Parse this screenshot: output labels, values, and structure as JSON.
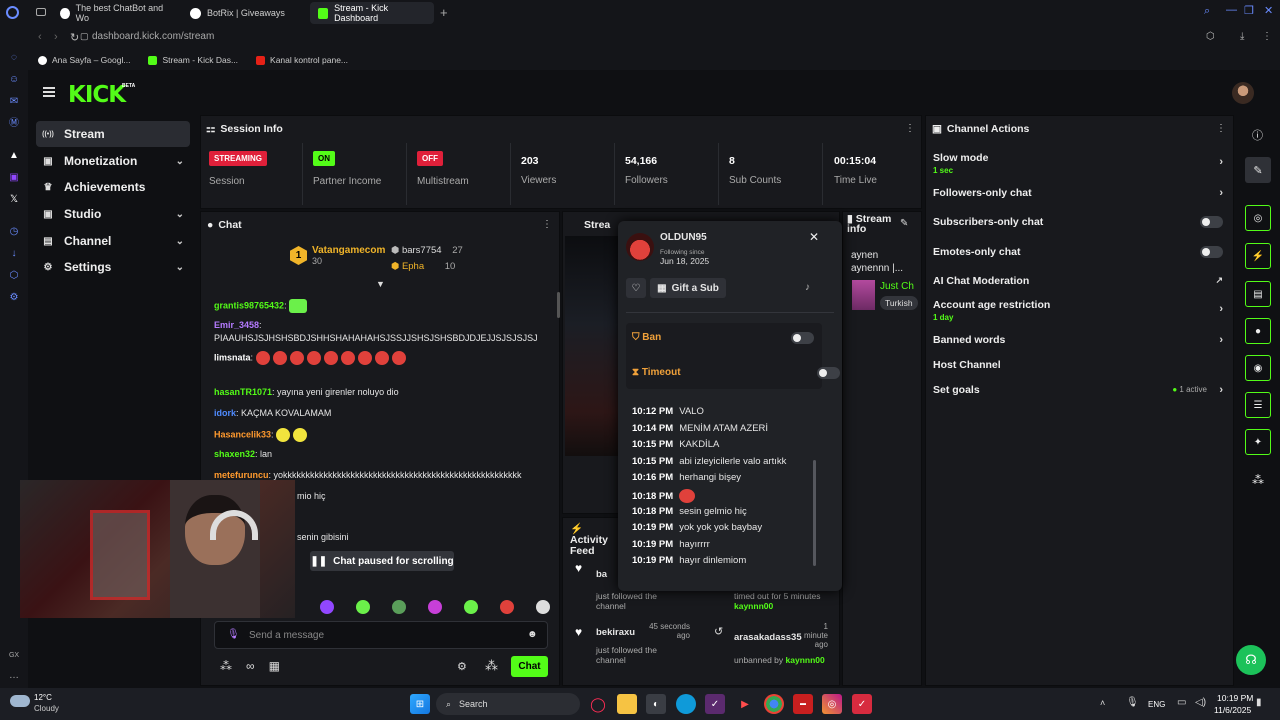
{
  "browser": {
    "tabs": [
      {
        "label": "The best ChatBot and Wo"
      },
      {
        "label": "BotRix | Giveaways"
      },
      {
        "label": "Stream - Kick Dashboard"
      }
    ],
    "url": "dashboard.kick.com/stream",
    "bookmarks": [
      "Ana Sayfa – Googl...",
      "Stream - Kick Das...",
      "Kanal kontrol pane..."
    ]
  },
  "brand": {
    "logo": "KICK",
    "beta": "BETA",
    "accent": "#53fc18"
  },
  "sidebar": {
    "items": [
      {
        "label": "Stream",
        "icon": "broadcast-icon",
        "glyph": "((•))"
      },
      {
        "label": "Monetization",
        "icon": "wallet-icon",
        "glyph": "▣"
      },
      {
        "label": "Achievements",
        "icon": "trophy-icon",
        "glyph": "♛"
      },
      {
        "label": "Studio",
        "icon": "studio-icon",
        "glyph": "▣"
      },
      {
        "label": "Channel",
        "icon": "channel-icon",
        "glyph": "▤"
      },
      {
        "label": "Settings",
        "icon": "gear-icon",
        "glyph": "⚙"
      }
    ]
  },
  "session": {
    "title": "Session Info",
    "stats": [
      {
        "badge": "STREAMING",
        "label": "Session"
      },
      {
        "badge": "ON",
        "label": "Partner Income"
      },
      {
        "badge": "OFF",
        "label": "Multistream"
      },
      {
        "value": "203",
        "label": "Viewers"
      },
      {
        "value": "54,166",
        "label": "Followers"
      },
      {
        "value": "8",
        "label": "Sub Counts"
      },
      {
        "value": "00:15:04",
        "label": "Time Live"
      }
    ]
  },
  "chat": {
    "title": "Chat",
    "top_gifters": [
      {
        "rank": "1",
        "name": "Vatangamecom",
        "count": "30"
      },
      {
        "name": "bars7754",
        "count": "27"
      },
      {
        "name": "Epha",
        "count": "10"
      }
    ],
    "messages": [
      {
        "user": "grantis98765432",
        "text": "",
        "color": "#53fc18"
      },
      {
        "user": "Emir_3458",
        "text": "PIAAUHSJSJHSHSBDJSHHSHAHAHAHSJSSJJSHSJSHSBDJDJEJJSJSJSJSJ",
        "color": "#b57bff"
      },
      {
        "user": "limsnata",
        "text": "",
        "color": "#53fc18"
      },
      {
        "user": "hasanTR1071",
        "text": "yayına yeni girenler noluyo dio",
        "color": "#53fc18"
      },
      {
        "user": "idork",
        "text": "KAÇMA KOVALAMAM",
        "color": "#4f8bff"
      },
      {
        "user": "Hasancelik33",
        "text": "",
        "color": "#ff9a2e"
      },
      {
        "user": "shaxen32",
        "text": "lan",
        "color": "#53fc18"
      },
      {
        "user": "metefuruncu",
        "text": "yokkkkkkkkkkkkkkkkkkkkkkkkkkkkkkkkkkkkkkkkkkkkkkkkkkkkk",
        "color": "#ff9a2e"
      },
      {
        "user": "",
        "text": "mio hiç",
        "color": "#53fc18"
      },
      {
        "user": "",
        "text": "senin gibisini",
        "color": "#53fc18"
      }
    ],
    "paused": "Chat paused for scrolling",
    "input_placeholder": "Send a message",
    "send": "Chat"
  },
  "popup": {
    "username": "OLDUN95",
    "following_label": "Following since",
    "following_date": "Jun 18, 2025",
    "gift": "Gift a Sub",
    "ban": "Ban",
    "timeout": "Timeout",
    "history": [
      {
        "time": "10:12 PM",
        "text": "VALO"
      },
      {
        "time": "10:14 PM",
        "text": "MENİM ATAM AZERİ"
      },
      {
        "time": "10:15 PM",
        "text": "KAKDİLA"
      },
      {
        "time": "10:15 PM",
        "text": "abi izleyicilerle valo artıkk"
      },
      {
        "time": "10:16 PM",
        "text": "herhangi bişey"
      },
      {
        "time": "10:18 PM",
        "text": ""
      },
      {
        "time": "10:18 PM",
        "text": "sesin gelmio hiç"
      },
      {
        "time": "10:19 PM",
        "text": "yok yok yok baybay"
      },
      {
        "time": "10:19 PM",
        "text": "hayırrrr"
      },
      {
        "time": "10:19 PM",
        "text": "hayır dinlemiom"
      }
    ]
  },
  "stream_panel": {
    "title": "Strea"
  },
  "stream_info": {
    "title": "Stream info",
    "stream_title": "aynen aynennn |...",
    "category": "Just Ch",
    "tag": "Turkish"
  },
  "activity": {
    "title": "Activity Feed",
    "items": [
      {
        "user": "ba",
        "action": "just followed the channel",
        "time": ""
      },
      {
        "user": "bekiraxu",
        "action": "just followed the channel",
        "time": "45 seconds ago"
      }
    ],
    "mod_items": [
      {
        "text": "timed out for 5 minutes",
        "by": "kaynnn00"
      },
      {
        "user": "arasakadass35",
        "text": "unbanned by",
        "by": "kaynnn00",
        "time": "1 minute ago"
      }
    ]
  },
  "actions": {
    "title": "Channel Actions",
    "items": [
      {
        "label": "Slow mode",
        "sub": "1 sec",
        "ctrl": "chevron"
      },
      {
        "label": "Followers-only chat",
        "sub": "",
        "ctrl": "chevron"
      },
      {
        "label": "Subscribers-only chat",
        "sub": "",
        "ctrl": "toggle"
      },
      {
        "label": "Emotes-only chat",
        "sub": "",
        "ctrl": "toggle"
      },
      {
        "label": "AI Chat Moderation",
        "sub": "",
        "ctrl": "external"
      },
      {
        "label": "Account age restriction",
        "sub": "1 day",
        "ctrl": "chevron"
      },
      {
        "label": "Banned words",
        "sub": "",
        "ctrl": "chevron"
      },
      {
        "label": "Host Channel",
        "sub": "",
        "ctrl": "none"
      },
      {
        "label": "Set goals",
        "sub": "",
        "ctrl": "chevron",
        "status": "1 active"
      }
    ]
  },
  "taskbar": {
    "weather_temp": "12°C",
    "weather_desc": "Cloudy",
    "search": "Search",
    "lang": "ENG",
    "time": "10:19 PM",
    "date": "11/6/2025"
  }
}
